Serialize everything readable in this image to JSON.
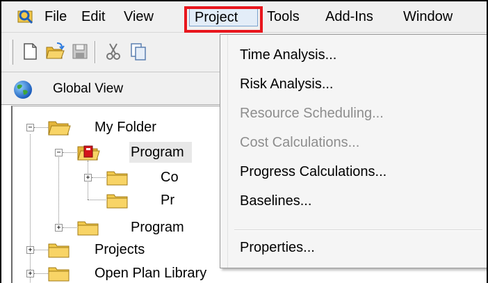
{
  "menubar": {
    "items": [
      {
        "label": "File"
      },
      {
        "label": "Edit"
      },
      {
        "label": "View"
      },
      {
        "label": "Project",
        "active": true
      },
      {
        "label": "Tools"
      },
      {
        "label": "Add-Ins"
      },
      {
        "label": "Window"
      }
    ]
  },
  "toolbar": {
    "icons": [
      "new-document-icon",
      "open-folder-icon",
      "save-icon",
      "cut-icon",
      "copy-icon"
    ]
  },
  "viewbar": {
    "label": "Global View",
    "icon": "globe-icon"
  },
  "tree": {
    "items": [
      {
        "label": "My Folder",
        "expander": "−"
      },
      {
        "label": "Program",
        "expander": "−"
      },
      {
        "label": "Co",
        "expander": "+"
      },
      {
        "label": "Pr",
        "expander": ""
      },
      {
        "label": "Program",
        "expander": "+"
      },
      {
        "label": "Projects",
        "expander": "+"
      },
      {
        "label": "Open Plan Library",
        "expander": "+"
      }
    ]
  },
  "dropdown": {
    "items": [
      {
        "label": "Time Analysis...",
        "enabled": true
      },
      {
        "label": "Risk Analysis...",
        "enabled": true
      },
      {
        "label": "Resource Scheduling...",
        "enabled": false
      },
      {
        "label": "Cost Calculations...",
        "enabled": false
      },
      {
        "label": "Progress Calculations...",
        "enabled": true
      },
      {
        "label": "Baselines...",
        "enabled": true
      },
      {
        "label": "Properties...",
        "enabled": true
      }
    ]
  },
  "colors": {
    "highlight": "#e8161d",
    "menu_bg": "#f0f0f0",
    "disabled_text": "#8d8d8d",
    "folder": "#f6c94b"
  }
}
